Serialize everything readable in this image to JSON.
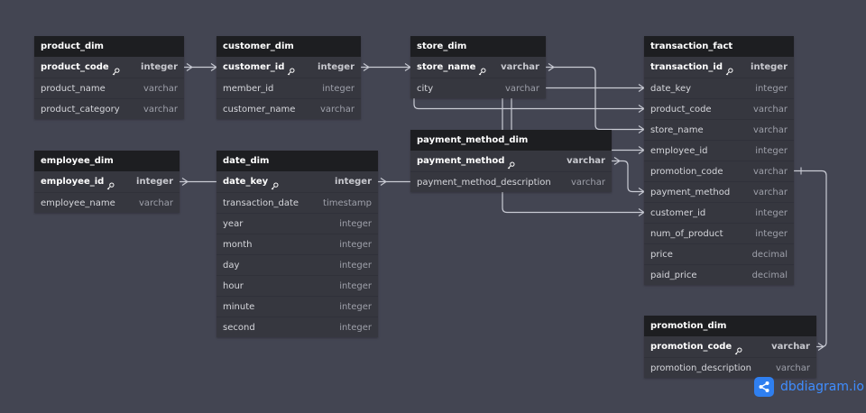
{
  "tables": {
    "product_dim": {
      "name": "product_dim",
      "fields": [
        {
          "name": "product_code",
          "type": "integer",
          "pk": true
        },
        {
          "name": "product_name",
          "type": "varchar",
          "pk": false
        },
        {
          "name": "product_category",
          "type": "varchar",
          "pk": false
        }
      ]
    },
    "customer_dim": {
      "name": "customer_dim",
      "fields": [
        {
          "name": "customer_id",
          "type": "integer",
          "pk": true
        },
        {
          "name": "member_id",
          "type": "integer",
          "pk": false
        },
        {
          "name": "customer_name",
          "type": "varchar",
          "pk": false
        }
      ]
    },
    "store_dim": {
      "name": "store_dim",
      "fields": [
        {
          "name": "store_name",
          "type": "varchar",
          "pk": true
        },
        {
          "name": "city",
          "type": "varchar",
          "pk": false
        }
      ]
    },
    "transaction_fact": {
      "name": "transaction_fact",
      "fields": [
        {
          "name": "transaction_id",
          "type": "integer",
          "pk": true
        },
        {
          "name": "date_key",
          "type": "integer",
          "pk": false
        },
        {
          "name": "product_code",
          "type": "varchar",
          "pk": false
        },
        {
          "name": "store_name",
          "type": "varchar",
          "pk": false
        },
        {
          "name": "employee_id",
          "type": "integer",
          "pk": false
        },
        {
          "name": "promotion_code",
          "type": "varchar",
          "pk": false
        },
        {
          "name": "payment_method",
          "type": "varchar",
          "pk": false
        },
        {
          "name": "customer_id",
          "type": "integer",
          "pk": false
        },
        {
          "name": "num_of_product",
          "type": "integer",
          "pk": false
        },
        {
          "name": "price",
          "type": "decimal",
          "pk": false
        },
        {
          "name": "paid_price",
          "type": "decimal",
          "pk": false
        }
      ]
    },
    "employee_dim": {
      "name": "employee_dim",
      "fields": [
        {
          "name": "employee_id",
          "type": "integer",
          "pk": true
        },
        {
          "name": "employee_name",
          "type": "varchar",
          "pk": false
        }
      ]
    },
    "date_dim": {
      "name": "date_dim",
      "fields": [
        {
          "name": "date_key",
          "type": "integer",
          "pk": true
        },
        {
          "name": "transaction_date",
          "type": "timestamp",
          "pk": false
        },
        {
          "name": "year",
          "type": "integer",
          "pk": false
        },
        {
          "name": "month",
          "type": "integer",
          "pk": false
        },
        {
          "name": "day",
          "type": "integer",
          "pk": false
        },
        {
          "name": "hour",
          "type": "integer",
          "pk": false
        },
        {
          "name": "minute",
          "type": "integer",
          "pk": false
        },
        {
          "name": "second",
          "type": "integer",
          "pk": false
        }
      ]
    },
    "payment_method_dim": {
      "name": "payment_method_dim",
      "fields": [
        {
          "name": "payment_method",
          "type": "varchar",
          "pk": true
        },
        {
          "name": "payment_method_description",
          "type": "varchar",
          "pk": false
        }
      ]
    },
    "promotion_dim": {
      "name": "promotion_dim",
      "fields": [
        {
          "name": "promotion_code",
          "type": "varchar",
          "pk": true
        },
        {
          "name": "promotion_description",
          "type": "varchar",
          "pk": false
        }
      ]
    }
  },
  "relationships": [
    {
      "from": "product_dim.product_code",
      "to": "customer_dim.customer_id"
    },
    {
      "from": "customer_dim.customer_id",
      "to": "store_dim.store_name"
    },
    {
      "from": "store_dim.store_name",
      "to": "transaction_fact.store_name"
    },
    {
      "from": "store_dim.city",
      "to": "transaction_fact.date_key"
    },
    {
      "from": "store_dim",
      "to": "transaction_fact.product_code"
    },
    {
      "from": "employee_dim.employee_id",
      "to": "date_dim.date_key"
    },
    {
      "from": "date_dim.date_key",
      "to": "payment_method_dim.payment_method"
    },
    {
      "from": "payment_method_dim",
      "to": "transaction_fact.employee_id"
    },
    {
      "from": "payment_method_dim.payment_method",
      "to": "transaction_fact.payment_method"
    },
    {
      "from": "payment_method_dim",
      "to": "transaction_fact.customer_id"
    },
    {
      "from": "transaction_fact.promotion_code",
      "to": "promotion_dim.promotion_code"
    }
  ],
  "colors": {
    "background": "#434552",
    "table_body": "#36373f",
    "table_header": "#1d1e21",
    "edge": "#c9cbd4",
    "brand": "#2f7ff0"
  },
  "icons": {
    "primary_key": "key-icon",
    "logo": "share-nodes-icon"
  },
  "logo": {
    "text": "dbdiagram.io"
  }
}
